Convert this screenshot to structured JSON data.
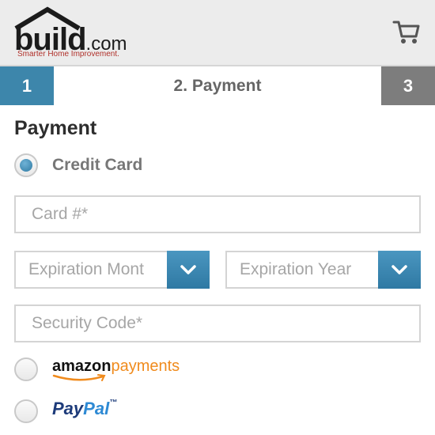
{
  "header": {
    "logo": {
      "word": "build",
      "suffix": ".com",
      "tagline": "Smarter Home Improvement."
    },
    "cart_icon": "cart-icon"
  },
  "steps": {
    "step1": "1",
    "step2": "2. Payment",
    "step3": "3"
  },
  "payment": {
    "title": "Payment",
    "credit_card_label": "Credit Card",
    "card_number_placeholder": "Card #*",
    "expiration_month_placeholder": "Expiration Mont",
    "expiration_year_placeholder": "Expiration Year",
    "security_code_placeholder": "Security Code*",
    "amazon": {
      "word": "amazon",
      "suffix": "payments"
    },
    "paypal": {
      "part1": "Pay",
      "part2": "Pal",
      "tm": "™"
    }
  },
  "colors": {
    "accent_blue": "#3d86ab",
    "step3_gray": "#7d7d7d",
    "header_bg": "#ececec",
    "amazon_orange": "#f08b1d",
    "paypal_dark": "#1d3b7a",
    "paypal_light": "#2e8ad4"
  }
}
